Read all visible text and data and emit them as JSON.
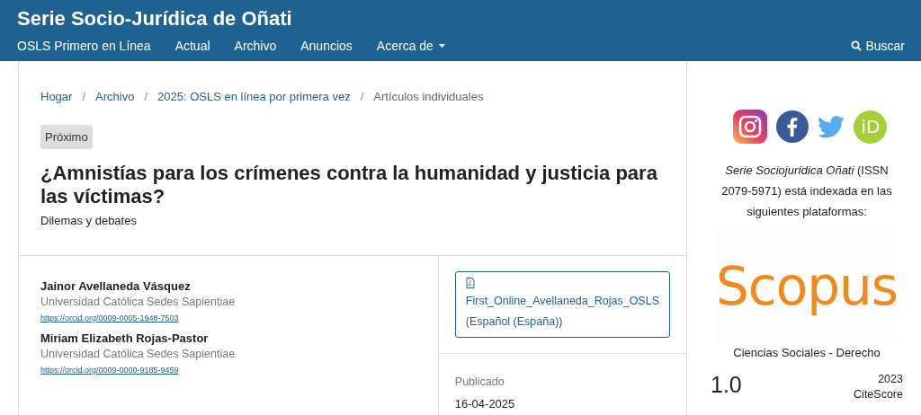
{
  "header": {
    "site_title": "Serie Socio-Jurídica de Oñati",
    "nav": [
      {
        "label": "OSLS Primero en Línea",
        "kind": "link"
      },
      {
        "label": "Actual",
        "kind": "link"
      },
      {
        "label": "Archivo",
        "kind": "link"
      },
      {
        "label": "Anuncios",
        "kind": "link"
      },
      {
        "label": "Acerca de",
        "kind": "dropdown"
      }
    ],
    "search": "Buscar"
  },
  "breadcrumb_separator": "/",
  "breadcrumb": [
    {
      "label": "Hogar",
      "kind": "link"
    },
    {
      "label": "Archivo",
      "kind": "link"
    },
    {
      "label": "2025: OSLS en línea por primera vez",
      "kind": "link"
    },
    {
      "label": "Artículos individuales",
      "kind": "current"
    }
  ],
  "article": {
    "badge": "Próximo",
    "title": "¿Amnistías para los crímenes contra la humanidad y justicia para las víctimas?",
    "subtitle": "Dilemas y debates",
    "authors": [
      {
        "name": "Jainor Avellaneda Vásquez",
        "affiliation": "Universidad Católica Sedes Sapientiae",
        "orcid": "https://orcid.org/0009-0005-1948-7503"
      },
      {
        "name": "Miriam Elizabeth Rojas-Pastor",
        "affiliation": "Universidad Católica Sedes Sapientiae",
        "orcid": "https://orcid.org/0009-0000-9185-9459"
      }
    ],
    "galley": {
      "label": "First_Online_Avellaneda_Rojas_OSLS",
      "language": "(Español (España))"
    },
    "published_label": "Publicado",
    "published_date": "16-04-2025"
  },
  "sidebar": {
    "social": [
      {
        "kind": "instagram"
      },
      {
        "kind": "facebook"
      },
      {
        "kind": "twitter"
      },
      {
        "kind": "orcid",
        "text": "iD"
      }
    ],
    "indexing_text": "*Serie Sociojurídica Oñati* (ISSN 2079-5971) está indexada en las siguientes plataformas:",
    "scopus_logo": "Scopus",
    "scopus_area": "Ciencias Sociales - Derecho",
    "citescore_value": "1.0",
    "citescore_year": "2023",
    "citescore_label": "CiteScore"
  }
}
